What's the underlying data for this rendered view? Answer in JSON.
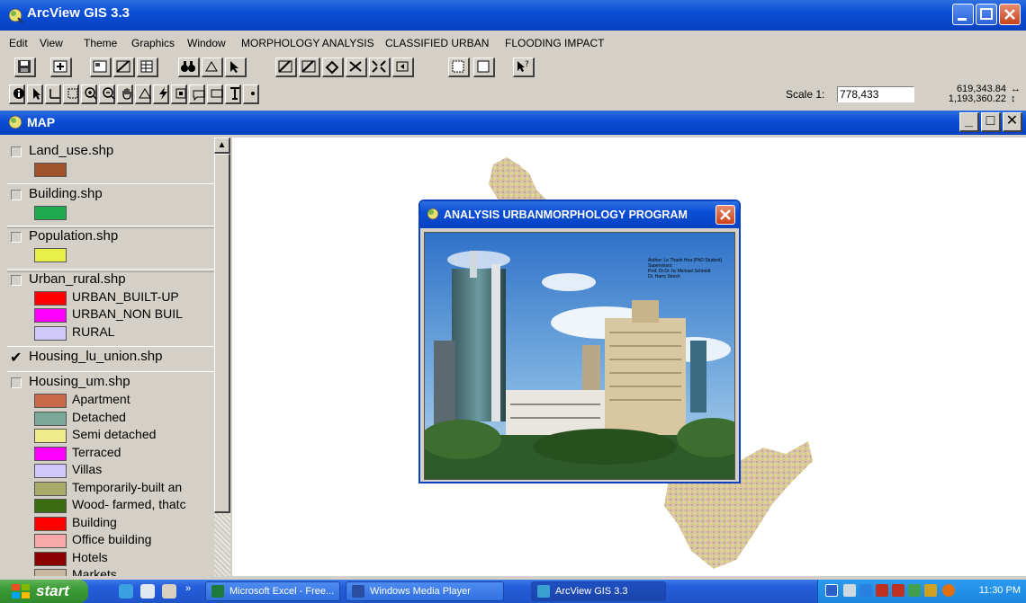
{
  "window": {
    "title": "ArcView GIS 3.3"
  },
  "menu": {
    "items": [
      "Edit",
      "View",
      "Theme",
      "Graphics",
      "Window",
      "MORPHOLOGY ANALYSIS",
      "CLASSIFIED URBAN",
      "FLOODING IMPACT"
    ]
  },
  "toolbar": {
    "scale_label": "Scale 1:",
    "scale_value": "778,433",
    "coord_x": "619,343.84",
    "coord_y": "1,193,360.22",
    "coord_arrows_x": "↔",
    "coord_arrows_y": "↕"
  },
  "map_window": {
    "title": "MAP",
    "minimize": "_",
    "restore": "□",
    "close": "✕"
  },
  "legend": {
    "layers": [
      {
        "name": "Land_use.shp",
        "checked": false,
        "symbols": [
          {
            "color": "#a0522d",
            "label": ""
          }
        ]
      },
      {
        "name": "Building.shp",
        "checked": false,
        "symbols": [
          {
            "color": "#1faa4f",
            "label": ""
          }
        ]
      },
      {
        "name": "Population.shp",
        "checked": false,
        "symbols": [
          {
            "color": "#e8f04a",
            "label": ""
          }
        ]
      },
      {
        "name": "Urban_rural.shp",
        "checked": false,
        "symbols": [
          {
            "color": "#ff0000",
            "label": "URBAN_BUILT-UP"
          },
          {
            "color": "#ff00ff",
            "label": "URBAN_NON BUIL"
          },
          {
            "color": "#cfc8f8",
            "label": "RURAL"
          }
        ]
      },
      {
        "name": "Housing_lu_union.shp",
        "checked": true,
        "symbols": []
      },
      {
        "name": "Housing_um.shp",
        "checked": false,
        "symbols": [
          {
            "color": "#c8694a",
            "label": "Apartment"
          },
          {
            "color": "#7ba899",
            "label": "Detached"
          },
          {
            "color": "#f0ec8c",
            "label": "Semi detached"
          },
          {
            "color": "#ff00ff",
            "label": "Terraced"
          },
          {
            "color": "#cfc8f8",
            "label": "Villas"
          },
          {
            "color": "#a8ac68",
            "label": "Temporarily-built an"
          },
          {
            "color": "#3d6b10",
            "label": "Wood- farmed, thatc"
          },
          {
            "color": "#ff0000",
            "label": "Building"
          },
          {
            "color": "#f8a8a8",
            "label": "Office building"
          },
          {
            "color": "#8b0000",
            "label": "Hotels"
          },
          {
            "color": "#c8b8a0",
            "label": "Markets"
          }
        ]
      }
    ],
    "checkmark": "✔",
    "scroll_up": "▲"
  },
  "dialog": {
    "title": "ANALYSIS URBANMORPHOLOGY PROGRAM",
    "credits": [
      "Author: Le Thanh Hoa (PhD Student)",
      "Supervisors:",
      "Prof. Dr.Dr. hc Michael Schmidt",
      "Dr. Harry Storch"
    ]
  },
  "taskbar": {
    "start": "start",
    "tasks": [
      {
        "label": "Microsoft Excel - Free...",
        "color": "#1d7a3a",
        "active": false
      },
      {
        "label": "Windows Media Player",
        "color": "#2a4fa0",
        "active": false
      },
      {
        "label": "ArcView GIS 3.3",
        "color": "#3aa0d0",
        "active": true
      }
    ],
    "clock": "11:30 PM"
  }
}
